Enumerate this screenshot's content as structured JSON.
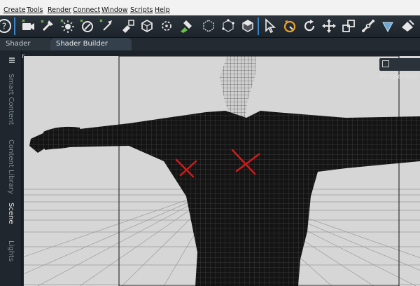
{
  "menu": [
    "Create",
    "Tools",
    "Render",
    "Connect",
    "Window",
    "Scripts",
    "Help"
  ],
  "toolbar": {
    "icons": [
      "help-icon",
      "create-camera-icon",
      "create-spotlight-icon",
      "create-point-light-icon",
      "create-distant-light-icon",
      "create-linear-light-icon",
      "new-primitive-icon",
      "node-weight-icon",
      "joint-editor-icon",
      "node-paint-icon",
      "geometry-editor-icon",
      "vertex-select-icon",
      "polygon-select-icon",
      "pointer-tool-icon",
      "universal-rotate-icon",
      "rotate-tool-icon",
      "translate-tool-icon",
      "scale-tool-icon",
      "joint-tool-icon",
      "surface-selection-icon",
      "render-icon"
    ]
  },
  "tabs": {
    "shader_mixer": "Shader Mixer",
    "shader_builder": "Shader Builder"
  },
  "side_tabs": {
    "smart_content": "Smart Content",
    "content_library": "Content Library",
    "scene": "Scene",
    "lights": "Lights"
  },
  "viewport": {
    "camera_label": "Perspective",
    "camera_icon": "viewport-camera-icon",
    "scene_subject": "wireframe-torso-figure"
  },
  "colors": {
    "annotation": "#d11a1a",
    "accent": "#3a86c8",
    "figure": "#101010",
    "background": "#d8d8d8"
  }
}
